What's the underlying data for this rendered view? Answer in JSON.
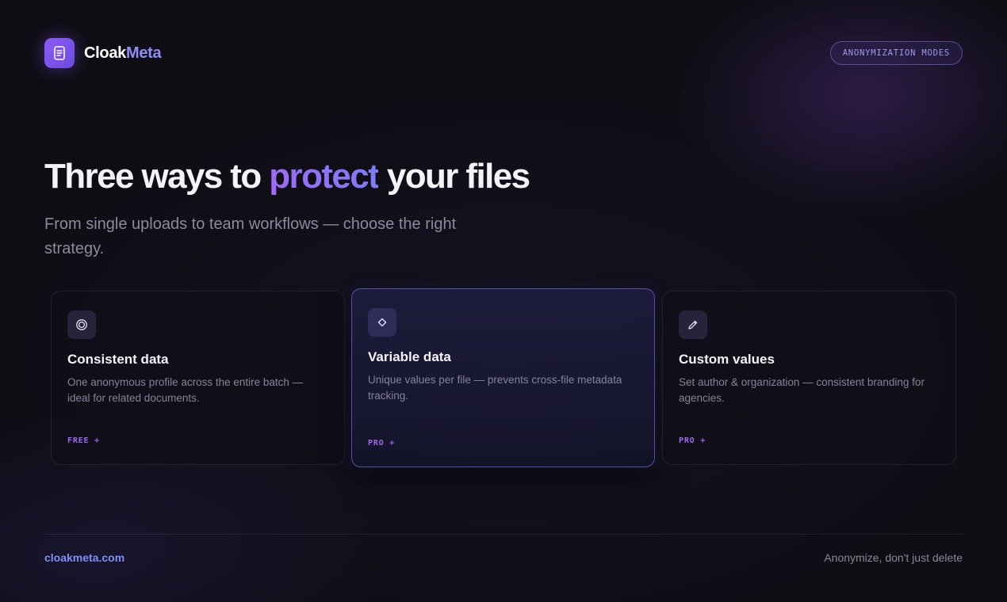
{
  "brand": {
    "name_part1": "Cloak",
    "name_part2": "Meta",
    "logo_icon": "document-icon"
  },
  "header": {
    "badge": "ANONYMIZATION MODES"
  },
  "hero": {
    "title_before": "Three ways to ",
    "title_highlight": "protect",
    "title_after": " your files",
    "subtitle": "From single uploads to team workflows — choose the right strategy."
  },
  "cards": [
    {
      "icon": "target-icon",
      "title": "Consistent data",
      "description": "One anonymous profile across the entire batch — ideal for related documents.",
      "tier": "FREE +"
    },
    {
      "icon": "diamond-icon",
      "title": "Variable data",
      "description": "Unique values per file — prevents cross-file metadata tracking.",
      "tier": "PRO +"
    },
    {
      "icon": "pencil-icon",
      "title": "Custom values",
      "description": "Set author & organization — consistent branding for agencies.",
      "tier": "PRO +"
    }
  ],
  "footer": {
    "link": "cloakmeta.com",
    "tagline": "Anonymize, don't just delete"
  },
  "colors": {
    "background": "#0e0d14",
    "accent_purple": "#8b5cf6",
    "accent_indigo": "#7f8ef7",
    "tier_label": "#a067f2"
  }
}
